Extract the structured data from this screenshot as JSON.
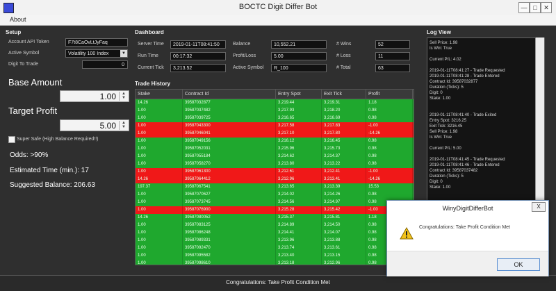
{
  "window": {
    "title": "BOCTC Digit Differ Bot"
  },
  "menu": {
    "about": "About"
  },
  "setup": {
    "title": "Setup",
    "api_token_label": "Account API Token",
    "api_token_value": "F7t8CaOvLtJyFaq",
    "symbol_label": "Active Symbol",
    "symbol_value": "Volatility 100 Index",
    "digit_label": "Digit To Trade",
    "digit_value": "0",
    "base_amount_label": "Base Amount",
    "base_amount_value": "1.00",
    "target_profit_label": "Target Profit",
    "target_profit_value": "5.00",
    "super_safe_label": "Super Safe (High Balance Required!!)",
    "odds": "Odds: >90%",
    "estimated_time": "Estimated Time (min.): 17",
    "suggested_balance": "Suggested Balance: 206.63"
  },
  "dashboard": {
    "title": "Dashboard",
    "server_time_label": "Server Time",
    "server_time_value": "2019-01-11T08:41:50",
    "run_time_label": "Run Time",
    "run_time_value": "00:17:32",
    "current_tick_label": "Current Tick",
    "current_tick_value": "3,213.52",
    "balance_label": "Balance",
    "balance_value": "10,552.21",
    "profit_label": "Profit/Loss",
    "profit_value": "5.00",
    "active_symbol_label": "Active Symbol",
    "active_symbol_value": "R_100",
    "wins_label": "# Wins",
    "wins_value": "52",
    "losses_label": "# Loss",
    "losses_value": "11",
    "total_label": "# Total",
    "total_value": "63"
  },
  "trade_history": {
    "title": "Trade History",
    "columns": [
      "Stake",
      "Contract Id",
      "Entry Spot",
      "Exit Tick",
      "Profit"
    ],
    "rows": [
      {
        "s": "g",
        "v": [
          "14.26",
          "39587032877",
          "3,219.44",
          "3,219.31",
          "1.18"
        ]
      },
      {
        "s": "g",
        "v": [
          "1.00",
          "39587037482",
          "3,217.93",
          "3,218.20",
          "0.98"
        ]
      },
      {
        "s": "g",
        "v": [
          "1.00",
          "39587039725",
          "3,216.65",
          "3,216.69",
          "0.98"
        ]
      },
      {
        "s": "r",
        "v": [
          "1.00",
          "39587043300",
          "3,217.58",
          "3,217.83",
          "-1.00"
        ]
      },
      {
        "s": "r",
        "v": [
          "1.00",
          "39587046041",
          "3,217.10",
          "3,217.80",
          "-14.26"
        ]
      },
      {
        "s": "g",
        "v": [
          "1.00",
          "39587049156",
          "3,216.12",
          "3,216.45",
          "0.98"
        ]
      },
      {
        "s": "g",
        "v": [
          "1.00",
          "39587052031",
          "3,215.96",
          "3,215.73",
          "0.98"
        ]
      },
      {
        "s": "g",
        "v": [
          "1.00",
          "39587055184",
          "3,214.62",
          "3,214.37",
          "0.98"
        ]
      },
      {
        "s": "g",
        "v": [
          "1.00",
          "39587058270",
          "3,213.80",
          "3,213.22",
          "0.98"
        ]
      },
      {
        "s": "r",
        "v": [
          "1.00",
          "39587061300",
          "3,212.61",
          "3,212.41",
          "-1.00"
        ]
      },
      {
        "s": "r",
        "v": [
          "14.26",
          "39587064412",
          "3,212.96",
          "3,213.41",
          "-14.26"
        ]
      },
      {
        "s": "g",
        "v": [
          "197.37",
          "39587067541",
          "3,213.65",
          "3,213.39",
          "15.53"
        ]
      },
      {
        "s": "g",
        "v": [
          "1.00",
          "39587070627",
          "3,214.02",
          "3,214.26",
          "0.98"
        ]
      },
      {
        "s": "g",
        "v": [
          "1.00",
          "39587073745",
          "3,214.56",
          "3,214.97",
          "0.98"
        ]
      },
      {
        "s": "r",
        "v": [
          "1.00",
          "39587076900",
          "3,215.28",
          "3,215.42",
          "-1.00"
        ]
      },
      {
        "s": "g",
        "v": [
          "14.26",
          "39587080052",
          "3,215.37",
          "3,215.81",
          "1.18"
        ]
      },
      {
        "s": "g",
        "v": [
          "1.00",
          "39587083125",
          "3,214.89",
          "3,214.50",
          "0.98"
        ]
      },
      {
        "s": "g",
        "v": [
          "1.00",
          "39587086248",
          "3,214.41",
          "3,214.07",
          "0.98"
        ]
      },
      {
        "s": "g",
        "v": [
          "1.00",
          "39587089331",
          "3,213.96",
          "3,213.88",
          "0.98"
        ]
      },
      {
        "s": "g",
        "v": [
          "1.00",
          "39587092470",
          "3,213.74",
          "3,213.61",
          "0.98"
        ]
      },
      {
        "s": "g",
        "v": [
          "1.00",
          "39587095582",
          "3,213.40",
          "3,213.15",
          "0.98"
        ]
      },
      {
        "s": "g",
        "v": [
          "1.00",
          "39587098610",
          "3,213.18",
          "3,212.96",
          "0.98"
        ]
      }
    ]
  },
  "log": {
    "title": "Log View",
    "lines": [
      "Sell Price: 1.98",
      "Is Win: True",
      "",
      "Current P/L: 4.02",
      "",
      "2019-01-11T08:41:27 - Trade Requested",
      "2019-01-11T08:41:28 - Trade Entered",
      "Contract Id: 39587032877",
      "Duration (Ticks): 5",
      "Digit: 0",
      "Stake: 1.00",
      "",
      "",
      "2019-01-11T08:41:40 - Trade Exited",
      "Entry Spot: 3216.25",
      "Exit Tick: 3216.45",
      "Sell Price: 1.98",
      "Is Win: True",
      "",
      "Current P/L: 5.00",
      "",
      "2019-01-11T08:41:45 - Trade Requested",
      "2019-01-11T08:41:46 - Trade Entered",
      "Contract Id: 39587037482",
      "Duration (Ticks): 5",
      "Digit: 0",
      "Stake: 1.00"
    ]
  },
  "status": {
    "message": "Congratulations: Take Profit Condition Met"
  },
  "dialog": {
    "title": "WinyDigitDifferBot",
    "message": "Congratulations: Take Profit Condition Met",
    "ok_label": "OK",
    "close_label": "X"
  }
}
